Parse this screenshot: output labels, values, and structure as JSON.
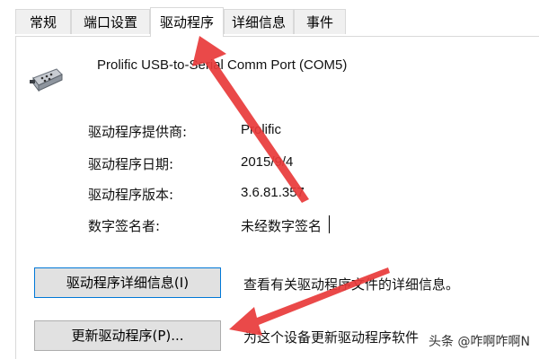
{
  "tabs": [
    {
      "label": "常规",
      "active": false
    },
    {
      "label": "端口设置",
      "active": false
    },
    {
      "label": "驱动程序",
      "active": true
    },
    {
      "label": "详细信息",
      "active": false
    },
    {
      "label": "事件",
      "active": false
    }
  ],
  "device": {
    "name": "Prolific USB-to-Serial Comm Port (COM5)",
    "icon": "serial-port-connector-icon"
  },
  "properties": [
    {
      "label": "驱动程序提供商:",
      "value": "Prolific"
    },
    {
      "label": "驱动程序日期:",
      "value": "2015/9/4"
    },
    {
      "label": "驱动程序版本:",
      "value": "3.6.81.357"
    },
    {
      "label": "数字签名者:",
      "value": "未经数字签名"
    }
  ],
  "actions": [
    {
      "button": "驱动程序详细信息(I)",
      "description": "查看有关驱动程序文件的详细信息。"
    },
    {
      "button": "更新驱动程序(P)...",
      "description": "为这个设备更新驱动程序软件"
    }
  ],
  "watermark": "头条 @咋啊咋啊N",
  "colors": {
    "annotation_arrow": "#e8393a",
    "focus_border": "#0078d7",
    "button_bg": "#e1e1e1"
  }
}
